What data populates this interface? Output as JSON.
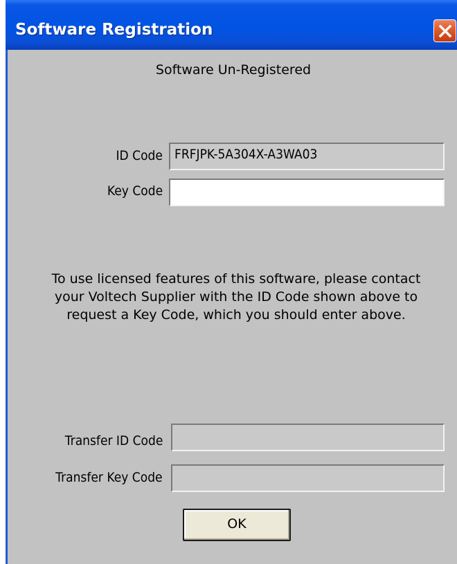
{
  "window": {
    "title": "Software Registration"
  },
  "status_text": "Software Un-Registered",
  "fields": {
    "id_code": {
      "label": "ID Code",
      "value": "FRFJPK-5A304X-A3WA03"
    },
    "key_code": {
      "label": "Key Code",
      "value": ""
    },
    "transfer_id_code": {
      "label": "Transfer ID Code",
      "value": ""
    },
    "transfer_key_code": {
      "label": "Transfer Key Code",
      "value": ""
    }
  },
  "message": {
    "line1": "To use licensed features of this software, please contact",
    "line2": "your Voltech Supplier with the ID Code shown above to",
    "line3": "request a Key Code, which you should enter above."
  },
  "buttons": {
    "ok_label": "OK"
  },
  "icons": {
    "close": "close-icon"
  },
  "colors": {
    "titlebar": "#0054e3",
    "dialog_bg": "#c2c2c2",
    "close_button": "#e05a2c"
  }
}
